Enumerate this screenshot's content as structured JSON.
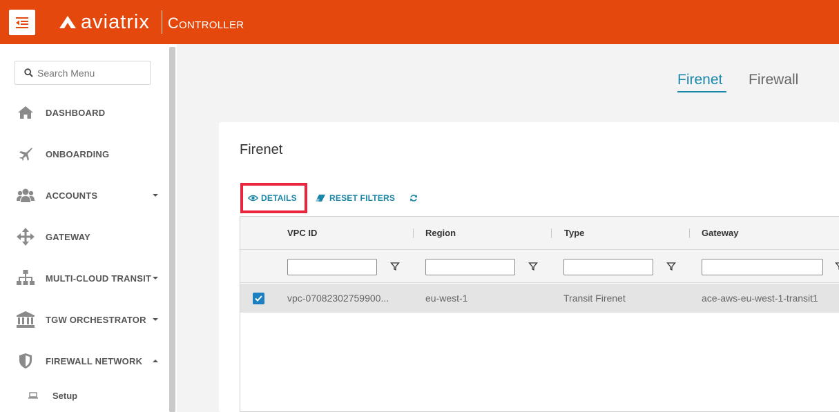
{
  "header": {
    "brand_name": "aviatrix",
    "brand_sub": "Controller"
  },
  "sidebar": {
    "search_placeholder": "Search Menu",
    "items": [
      {
        "label": "DASHBOARD",
        "icon": "home-icon"
      },
      {
        "label": "ONBOARDING",
        "icon": "airplane-icon"
      },
      {
        "label": "ACCOUNTS",
        "icon": "users-icon",
        "caret": "down"
      },
      {
        "label": "GATEWAY",
        "icon": "move-arrows-icon"
      },
      {
        "label": "MULTI-CLOUD TRANSIT",
        "icon": "sitemap-icon",
        "caret": "down"
      },
      {
        "label": "TGW ORCHESTRATOR",
        "icon": "bank-icon",
        "caret": "down"
      },
      {
        "label": "FIREWALL NETWORK",
        "icon": "shield-icon",
        "caret": "up"
      }
    ],
    "sub_items": [
      {
        "label": "Setup",
        "icon": "laptop-icon"
      }
    ]
  },
  "tabs": [
    {
      "label": "Firenet",
      "active": true
    },
    {
      "label": "Firewall",
      "active": false
    }
  ],
  "card": {
    "title": "Firenet",
    "toolbar": {
      "details_label": "DETAILS",
      "reset_filters_label": "RESET FILTERS"
    }
  },
  "table": {
    "columns": [
      "VPC ID",
      "Region",
      "Type",
      "Gateway"
    ],
    "rows": [
      {
        "selected": true,
        "cells": [
          "vpc-07082302759900...",
          "eu-west-1",
          "Transit Firenet",
          "ace-aws-eu-west-1-transit1"
        ]
      }
    ]
  },
  "colors": {
    "brand": "#e4480c",
    "accent": "#1b87a8",
    "highlight": "#e8253c",
    "checkbox": "#1b7fc0"
  }
}
